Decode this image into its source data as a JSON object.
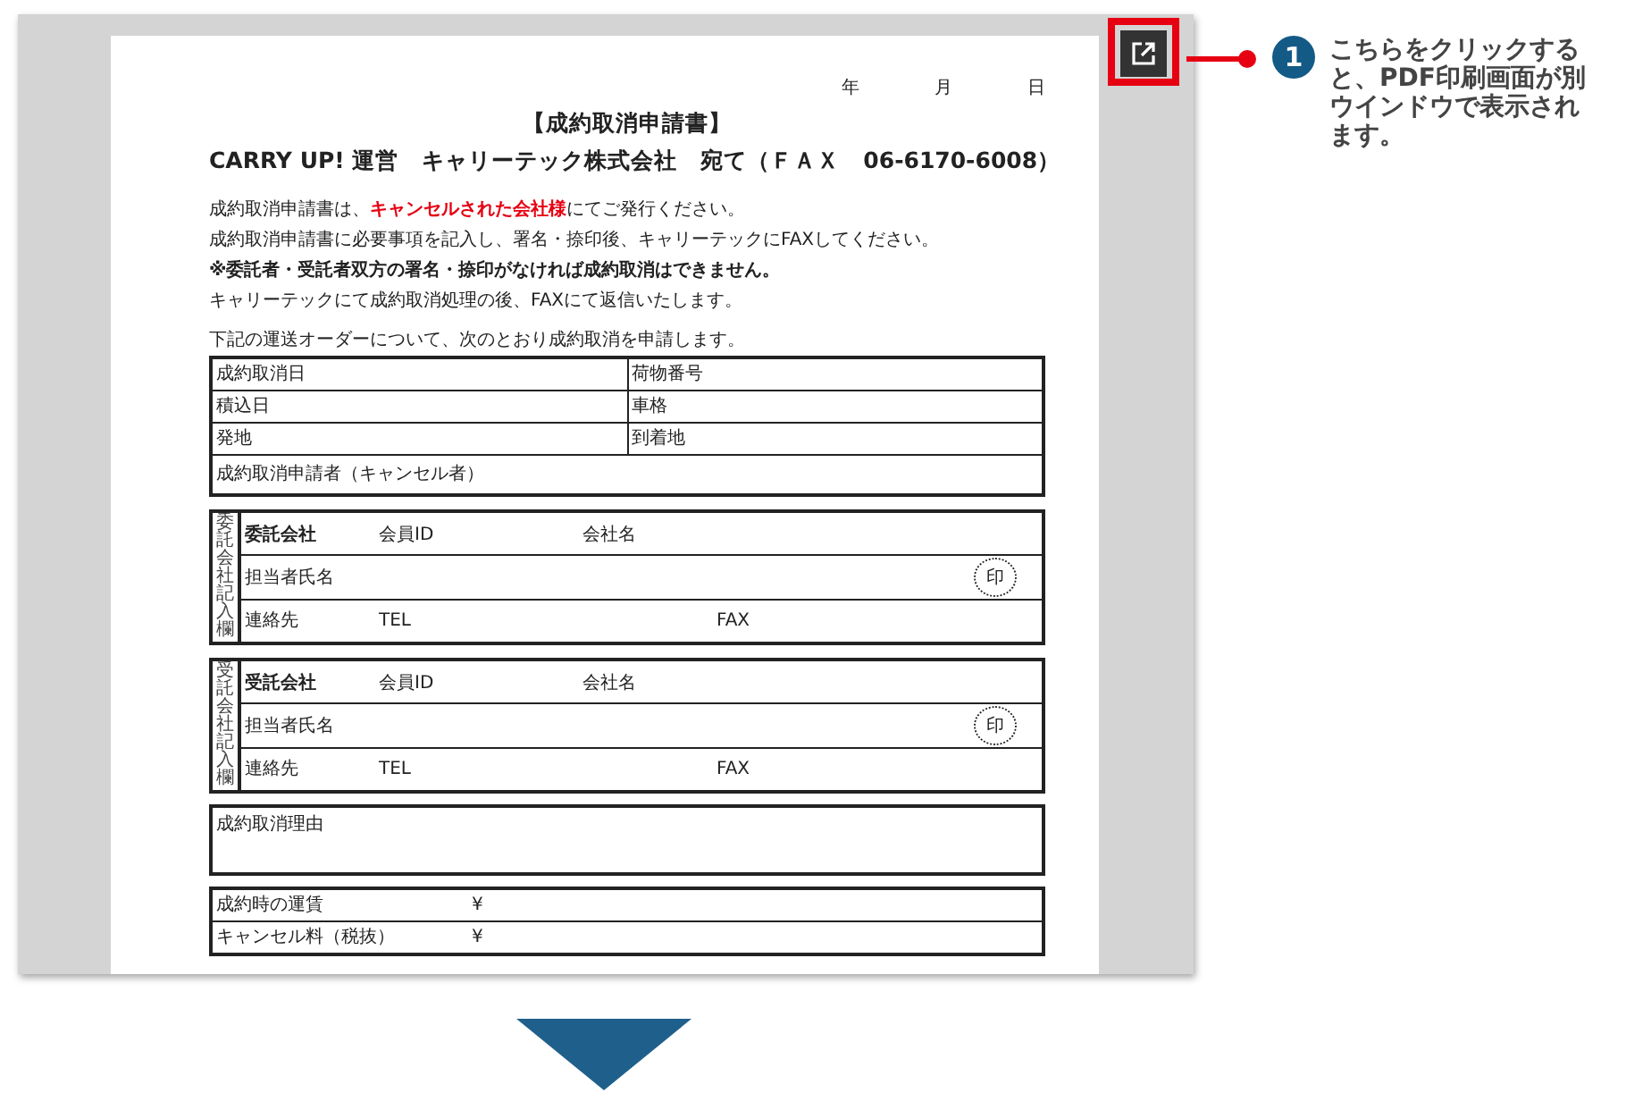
{
  "document": {
    "date_labels": [
      "年",
      "月",
      "日"
    ],
    "title": "【成約取消申請書】",
    "addressee": "CARRY UP! 運営　キャリーテック株式会社　宛て（ＦＡＸ　06-6170-6008）",
    "instructions": [
      {
        "kind": "highlight",
        "text": "成約取消申請書は、**キャンセルされた会社様**にてご発行ください。"
      },
      {
        "kind": "plain",
        "text": "成約取消申請書に必要事項を記入し、署名・捺印後、キャリーテックにFAXしてください。"
      },
      {
        "kind": "warning",
        "text": "※委託者・受託者双方の署名・捺印がなければ成約取消はできません。"
      },
      {
        "kind": "plain",
        "text": "キャリーテックにて成約取消処理の後、FAXにて返信いたします。"
      }
    ],
    "intro": "下記の運送オーダーについて、次のとおり成約取消を申請します。",
    "order_rows": [
      [
        "成約取消日",
        "荷物番号"
      ],
      [
        "積込日",
        "車格"
      ],
      [
        "発地",
        "到着地"
      ],
      [
        "成約取消申請者（キャンセル者）"
      ]
    ],
    "companies": [
      {
        "side_label": "委託会社記入欄",
        "name": "委託会社",
        "member_id_label": "会員ID",
        "company_name_label": "会社名",
        "person_label": "担当者氏名",
        "seal": "印",
        "contact_label": "連絡先",
        "tel_label": "TEL",
        "fax_label": "FAX"
      },
      {
        "side_label": "受託会社記入欄",
        "name": "受託会社",
        "member_id_label": "会員ID",
        "company_name_label": "会社名",
        "person_label": "担当者氏名",
        "seal": "印",
        "contact_label": "連絡先",
        "tel_label": "TEL",
        "fax_label": "FAX"
      }
    ],
    "reason_label": "成約取消理由",
    "fees": [
      {
        "label": "成約時の運賃",
        "currency": "¥"
      },
      {
        "label": "キャンセル料（税抜）",
        "currency": "¥"
      }
    ]
  },
  "callout": {
    "step": "1",
    "text": "こちらをクリックすると、PDF印刷画面が別ウインドウで表示されます。"
  }
}
